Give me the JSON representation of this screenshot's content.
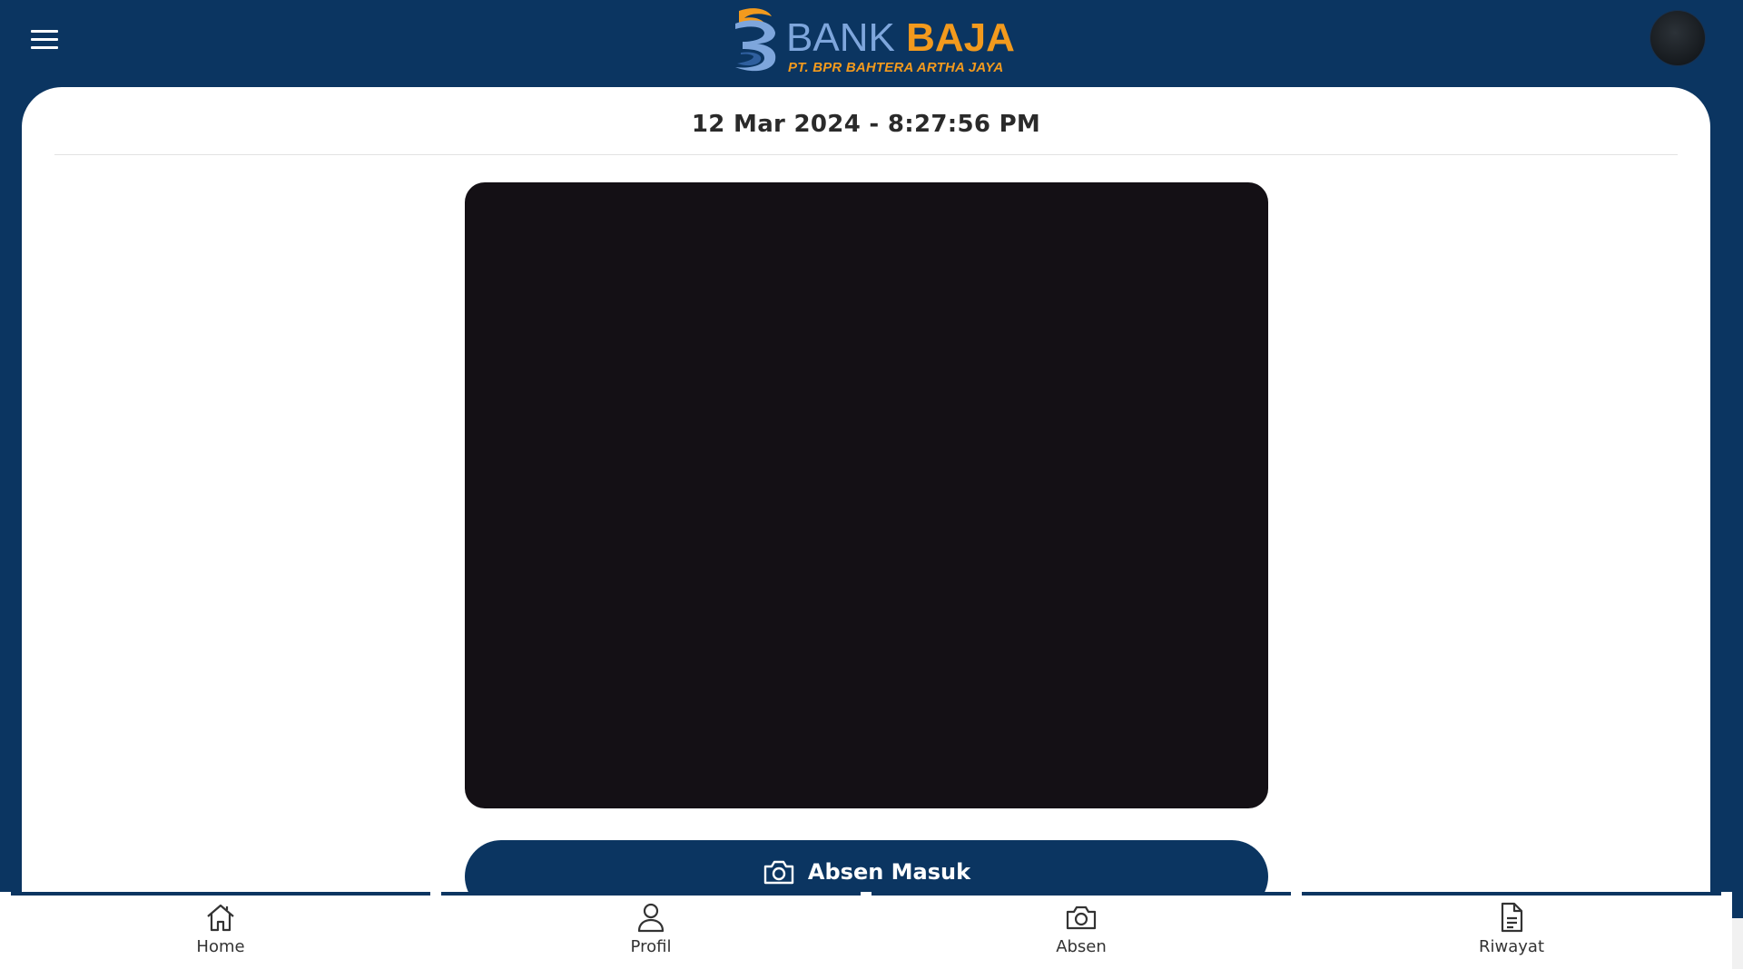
{
  "header": {
    "logo": {
      "brand_word1": "BANK",
      "brand_word2": "BAJA",
      "subtitle": "PT. BPR BAHTERA ARTHA JAYA"
    },
    "menu_icon": "hamburger-menu-icon",
    "avatar_icon": "user-avatar"
  },
  "main": {
    "datetime": "12 Mar 2024 - 8:27:56 PM",
    "absen_button": {
      "label": "Absen Masuk",
      "icon": "camera-icon"
    }
  },
  "bottom_nav": {
    "items": [
      {
        "label": "Home",
        "icon": "home-icon"
      },
      {
        "label": "Profil",
        "icon": "user-icon"
      },
      {
        "label": "Absen",
        "icon": "camera-icon"
      },
      {
        "label": "Riwayat",
        "icon": "document-icon"
      }
    ]
  },
  "colors": {
    "primary": "#0b3561",
    "accent_orange": "#f39a1d",
    "logo_blue": "#7ea6dc",
    "camera_bg": "#141015"
  }
}
